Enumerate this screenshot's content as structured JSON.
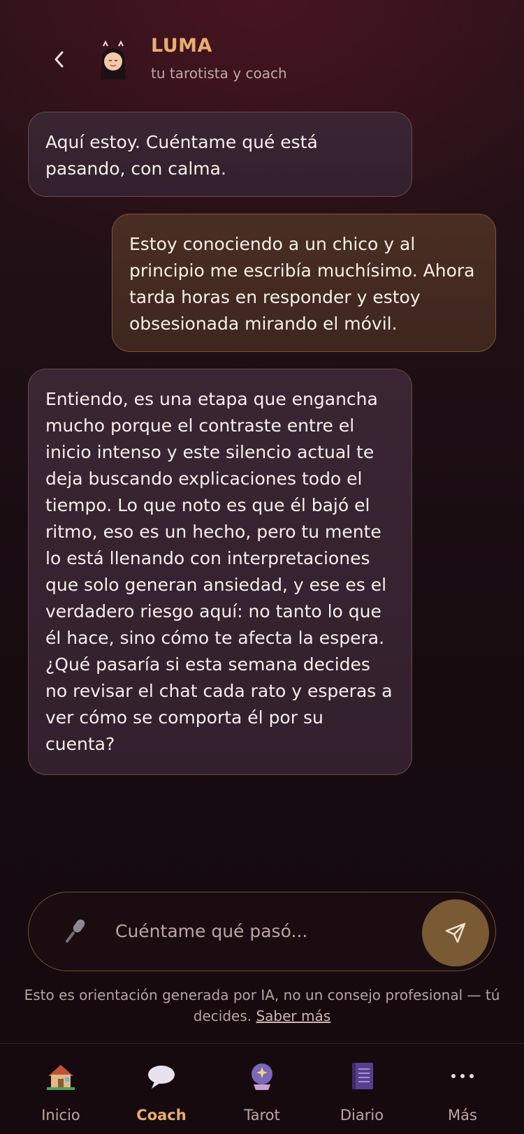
{
  "header": {
    "title": "LUMA",
    "subtitle": "tu tarotista y coach"
  },
  "messages": [
    {
      "role": "bot",
      "text": "Aquí estoy. Cuéntame qué está pasando, con calma."
    },
    {
      "role": "user",
      "text": "Estoy conociendo a un chico y al principio me escribía muchísimo. Ahora tarda horas en responder y estoy obsesionada mirando el móvil."
    },
    {
      "role": "bot",
      "text": "Entiendo, es una etapa que engancha mucho porque el contraste entre el inicio intenso y este silencio actual te deja buscando explicaciones todo el tiempo. Lo que noto es que él bajó el ritmo, eso es un hecho, pero tu mente lo está llenando con interpretaciones que solo generan ansiedad, y ese es el verdadero riesgo aquí: no tanto lo que él hace, sino cómo te afecta la espera. ¿Qué pasaría si esta semana decides no revisar el chat cada rato y esperas a ver cómo se comporta él por su cuenta?"
    }
  ],
  "composer": {
    "placeholder": "Cuéntame qué pasó...",
    "value": ""
  },
  "disclaimer": {
    "text": "Esto es orientación generada por IA, no un consejo profesional — tú decides. ",
    "link": "Saber más"
  },
  "tabs": [
    {
      "label": "Inicio",
      "icon": "house-icon",
      "active": false
    },
    {
      "label": "Coach",
      "icon": "speech-bubble-icon",
      "active": true
    },
    {
      "label": "Tarot",
      "icon": "crystal-ball-icon",
      "active": false
    },
    {
      "label": "Diario",
      "icon": "notebook-icon",
      "active": false
    },
    {
      "label": "Más",
      "icon": "more-icon",
      "active": false
    }
  ],
  "colors": {
    "accent": "#e8ae6e",
    "bot_bubble": "#382331",
    "user_bubble": "#45291f",
    "send_button": "#7a5a35",
    "background": "#1a0c12"
  }
}
